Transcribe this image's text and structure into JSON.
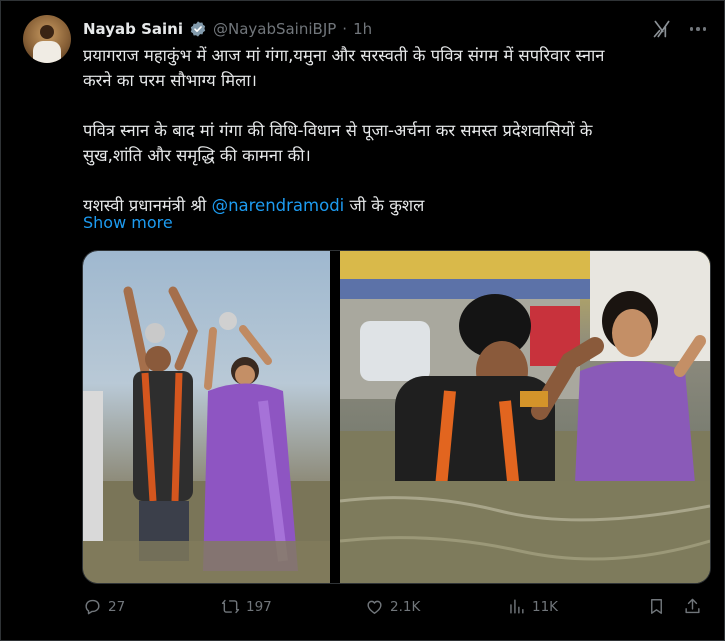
{
  "author": {
    "name": "Nayab Saini",
    "handle": "@NayabSainiBJP",
    "separator": "·",
    "time": "1h"
  },
  "tweet": {
    "lines": [
      "प्रयागराज महाकुंभ में आज मां गंगा,यमुना और सरस्वती के पवित्र संगम में सपरिवार स्नान",
      "करने का परम सौभाग्य मिला।",
      "पवित्र स्नान के बाद मां गंगा की विधि-विधान से पूजा-अर्चना कर समस्त प्रदेशवासियों के",
      "सुख,शांति और समृद्धि की कामना की।"
    ],
    "last_line_prefix": "यशस्वी प्रधानमंत्री श्री ",
    "mention": "@narendramodi",
    "last_line_suffix": " जी के कुशल",
    "show_more": "Show more"
  },
  "media": {
    "photo_count": 2,
    "photo1_desc": "man and woman raising vessels in river",
    "photo2_desc": "man and woman taking holy dip"
  },
  "actions": {
    "reply_count": "27",
    "retweet_count": "197",
    "like_count": "2.1K",
    "view_count": "11K"
  },
  "colors": {
    "background": "#000000",
    "text": "#e7e9ea",
    "muted": "#71767b",
    "accent": "#1d9bf0"
  },
  "icons": [
    "verified-badge-icon",
    "grok-icon",
    "more-icon",
    "reply-icon",
    "retweet-icon",
    "like-icon",
    "views-icon",
    "bookmark-icon",
    "share-icon"
  ]
}
